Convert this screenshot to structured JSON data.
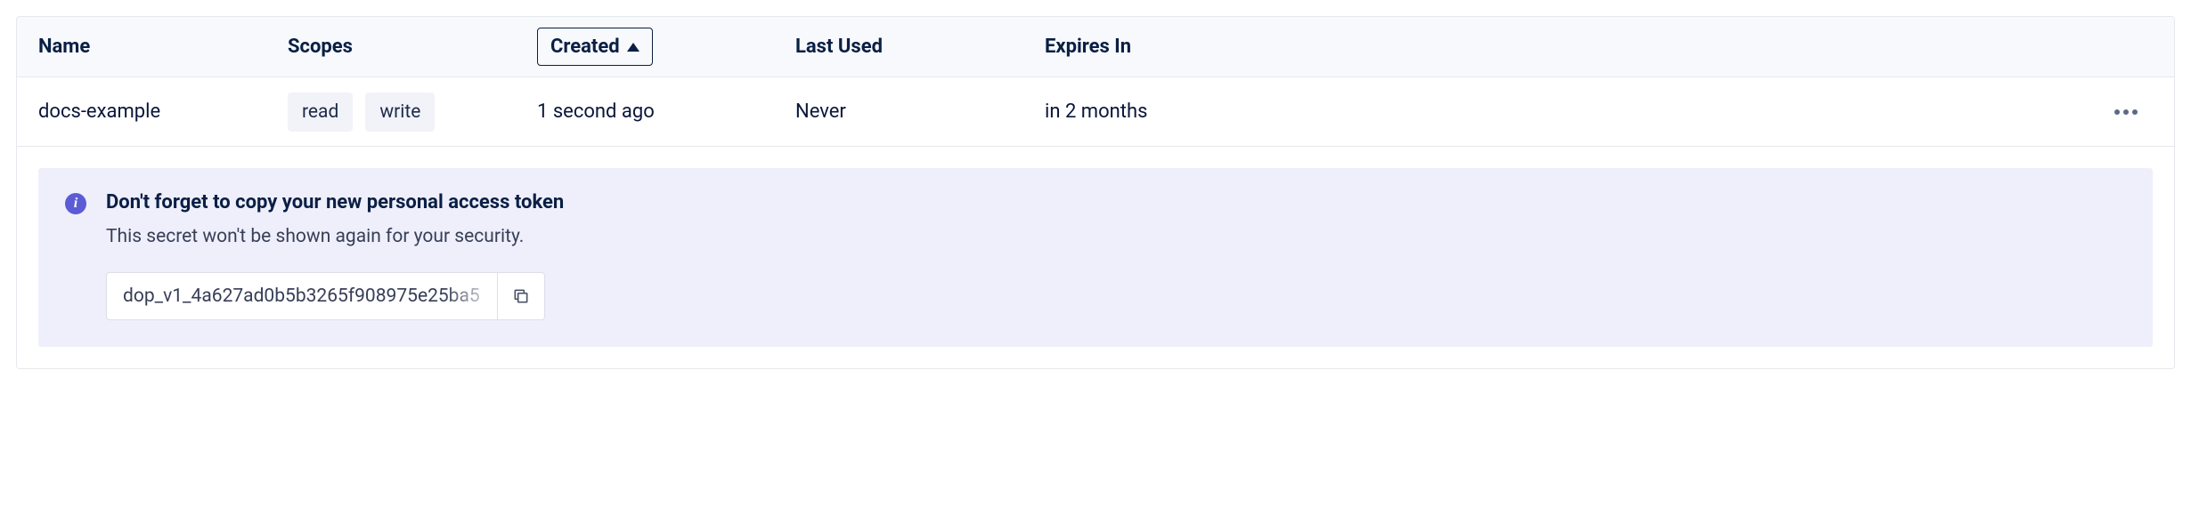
{
  "table": {
    "headers": {
      "name": "Name",
      "scopes": "Scopes",
      "created": "Created",
      "last_used": "Last Used",
      "expires_in": "Expires In"
    },
    "sort_column": "created",
    "sort_direction": "asc",
    "rows": [
      {
        "name": "docs-example",
        "scopes": [
          "read",
          "write"
        ],
        "created": "1 second ago",
        "last_used": "Never",
        "expires_in": "in 2 months"
      }
    ]
  },
  "banner": {
    "title": "Don't forget to copy your new personal access token",
    "subtitle": "This secret won't be shown again for your security.",
    "token": "dop_v1_4a627ad0b5b3265f908975e25ba5"
  }
}
